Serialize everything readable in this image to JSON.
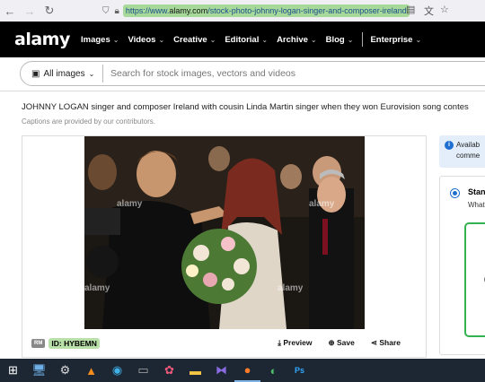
{
  "browser": {
    "url_prefix": "https://www.",
    "url_domain": "alamy.com",
    "url_path": "/stock-photo-johnny-logan-singer-and-composer-ireland"
  },
  "header": {
    "logo": "alamy",
    "menu": [
      {
        "label": "Images"
      },
      {
        "label": "Videos"
      },
      {
        "label": "Creative"
      },
      {
        "label": "Editorial"
      },
      {
        "label": "Archive"
      },
      {
        "label": "Blog"
      }
    ],
    "enterprise": "Enterprise"
  },
  "search": {
    "scope": "All images",
    "placeholder": "Search for stock images, vectors and videos"
  },
  "image": {
    "title": "JOHNNY LOGAN singer and composer Ireland with cousin Linda Martin singer when they won Eurovision song contes",
    "caption_note": "Captions are provided by our contributors.",
    "rm_badge": "RM",
    "id_label": "ID:",
    "id_value": "HYBEMN",
    "watermark": "alamy"
  },
  "actions": {
    "preview": "Preview",
    "save": "Save",
    "share": "Share"
  },
  "side": {
    "info_line1": "Availab",
    "info_line2": "comme",
    "license_title": "Stan",
    "license_sub": "What",
    "box_text": "("
  },
  "colors": {
    "header_bg": "#000000",
    "accent_blue": "#1e6fd0",
    "green_border": "#33b24f",
    "id_highlight": "#b8e0a8"
  }
}
